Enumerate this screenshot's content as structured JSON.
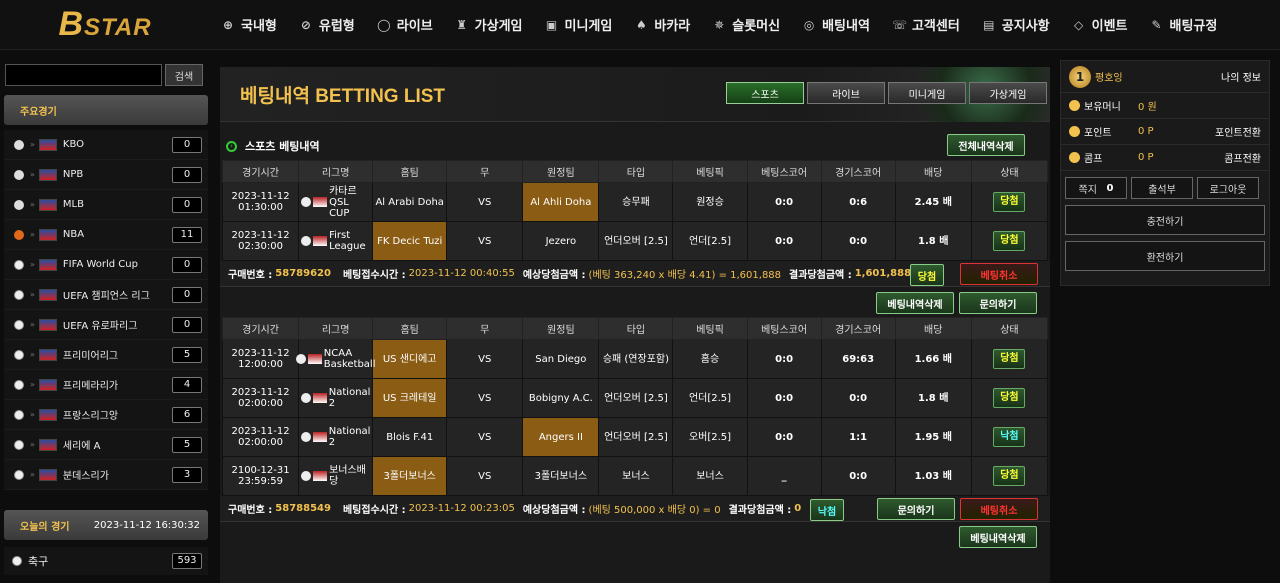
{
  "brand": {
    "logo_b": "B",
    "logo_rest": "STAR"
  },
  "nav": [
    {
      "label": "국내형",
      "icon": "⊕"
    },
    {
      "label": "유럽형",
      "icon": "⊘"
    },
    {
      "label": "라이브",
      "icon": "◯"
    },
    {
      "label": "가상게임",
      "icon": "♜"
    },
    {
      "label": "미니게임",
      "icon": "▣"
    },
    {
      "label": "바카라",
      "icon": "♠"
    },
    {
      "label": "슬롯머신",
      "icon": "✵"
    },
    {
      "label": "배팅내역",
      "icon": "◎"
    },
    {
      "label": "고객센터",
      "icon": "☏"
    },
    {
      "label": "공지사항",
      "icon": "▤"
    },
    {
      "label": "이벤트",
      "icon": "◇"
    },
    {
      "label": "배팅규정",
      "icon": "✎"
    }
  ],
  "left": {
    "search_btn": "검색",
    "panel_title": "주요경기",
    "leagues": [
      {
        "name": "KBO",
        "count": "0",
        "ball": "base"
      },
      {
        "name": "NPB",
        "count": "0",
        "ball": "base"
      },
      {
        "name": "MLB",
        "count": "0",
        "ball": "base"
      },
      {
        "name": "NBA",
        "count": "11",
        "ball": "basket"
      },
      {
        "name": "FIFA World Cup",
        "count": "0",
        "ball": "soccer"
      },
      {
        "name": "UEFA 챔피언스 리그",
        "count": "0",
        "ball": "soccer"
      },
      {
        "name": "UEFA 유로파리그",
        "count": "0",
        "ball": "soccer"
      },
      {
        "name": "프리미어리그",
        "count": "5",
        "ball": "soccer"
      },
      {
        "name": "프리메라리가",
        "count": "4",
        "ball": "soccer"
      },
      {
        "name": "프랑스리그앙",
        "count": "6",
        "ball": "soccer"
      },
      {
        "name": "세리에 A",
        "count": "5",
        "ball": "soccer"
      },
      {
        "name": "분데스리가",
        "count": "3",
        "ball": "soccer"
      }
    ],
    "today_title": "오늘의 경기",
    "today_time": "2023-11-12 16:30:32",
    "sport_name": "축구",
    "sport_count": "593"
  },
  "main": {
    "title": "베팅내역 BETTING LIST",
    "tabs": [
      "스포츠",
      "라이브",
      "미니게임",
      "가상게임"
    ],
    "section_title": "스포츠 베팅내역",
    "delete_all": "전체내역삭제",
    "headers": [
      "경기시간",
      "리그명",
      "홈팀",
      "무",
      "원정팀",
      "타입",
      "베팅픽",
      "베팅스코어",
      "경기스코어",
      "배당",
      "상태"
    ],
    "group1": {
      "rows": [
        {
          "time": "2023-11-12 01:30:00",
          "league": "카타르 QSL CUP",
          "home": "Al Arabi Doha",
          "draw": "VS",
          "away": "Al Ahli Doha",
          "type": "승무패",
          "pick": "원정승",
          "bet_score": "0:0",
          "game_score": "0:6",
          "odds": "2.45 배",
          "status": "당첨",
          "hl": "away"
        },
        {
          "time": "2023-11-12 02:30:00",
          "league": "First League",
          "home": "FK Decic Tuzi",
          "draw": "VS",
          "away": "Jezero",
          "type": "언더오버 [2.5]",
          "pick": "언더[2.5]",
          "bet_score": "0:0",
          "game_score": "0:0",
          "odds": "1.8 배",
          "status": "당첨",
          "hl": "home"
        }
      ],
      "summary": {
        "buy_label": "구매번호 :",
        "buy_no": "58789620",
        "time_label": "베팅접수시간 :",
        "time": "2023-11-12 00:40:55",
        "exp_label": "예상당첨금액 :",
        "exp": "(베팅 363,240 x 배당 4.41) = 1,601,888",
        "res_label": "결과당첨금액 :",
        "res": "1,601,888",
        "status": "당첨",
        "cancel": "베팅취소"
      },
      "btn_delete": "베팅내역삭제",
      "btn_inquiry": "문의하기"
    },
    "group2": {
      "rows": [
        {
          "time": "2023-11-12 12:00:00",
          "league": "NCAA Basketball",
          "home": "US 샌디에고",
          "draw": "VS",
          "away": "San Diego",
          "type": "승패 (연장포함)",
          "pick": "홈승",
          "bet_score": "0:0",
          "game_score": "69:63",
          "odds": "1.66 배",
          "status": "당첨",
          "hl": "home"
        },
        {
          "time": "2023-11-12 02:00:00",
          "league": "National 2",
          "home": "US 크레테일",
          "draw": "VS",
          "away": "Bobigny A.C.",
          "type": "언더오버 [2.5]",
          "pick": "언더[2.5]",
          "bet_score": "0:0",
          "game_score": "0:0",
          "odds": "1.8 배",
          "status": "당첨",
          "hl": "home"
        },
        {
          "time": "2023-11-12 02:00:00",
          "league": "National 2",
          "home": "Blois F.41",
          "draw": "VS",
          "away": "Angers II",
          "type": "언더오버 [2.5]",
          "pick": "오버[2.5]",
          "bet_score": "0:0",
          "game_score": "1:1",
          "odds": "1.95 배",
          "status": "낙첨",
          "hl": "away"
        },
        {
          "time": "2100-12-31 23:59:59",
          "league": "보너스배당",
          "home": "3폴더보너스",
          "draw": "VS",
          "away": "3폴더보너스",
          "type": "보너스",
          "pick": "보너스",
          "bet_score": "_",
          "game_score": "0:0",
          "odds": "1.03 배",
          "status": "당첨",
          "hl": "home"
        }
      ],
      "summary": {
        "buy_label": "구매번호 :",
        "buy_no": "58788549",
        "time_label": "베팅접수시간 :",
        "time": "2023-11-12 00:23:05",
        "exp_label": "예상당첨금액 :",
        "exp": "(베팅 500,000 x 배당 0) = 0",
        "res_label": "결과당첨금액 :",
        "res": "0",
        "status": "낙첨",
        "inquiry": "문의하기",
        "cancel": "베팅취소"
      },
      "btn_delete": "베팅내역삭제"
    }
  },
  "right": {
    "rank_badge": "1",
    "rank_label": "평호잉",
    "my_info": "나의 정보",
    "money_label": "보유머니",
    "money": "0 원",
    "point_label": "포인트",
    "point": "0 P",
    "point_link": "포인트전환",
    "comp_label": "콤프",
    "comp": "0 P",
    "comp_link": "콤프전환",
    "note_label": "쪽지",
    "note_count": "0",
    "attend": "출석부",
    "logout": "로그아웃",
    "deposit": "충전하기",
    "withdraw": "환전하기"
  }
}
